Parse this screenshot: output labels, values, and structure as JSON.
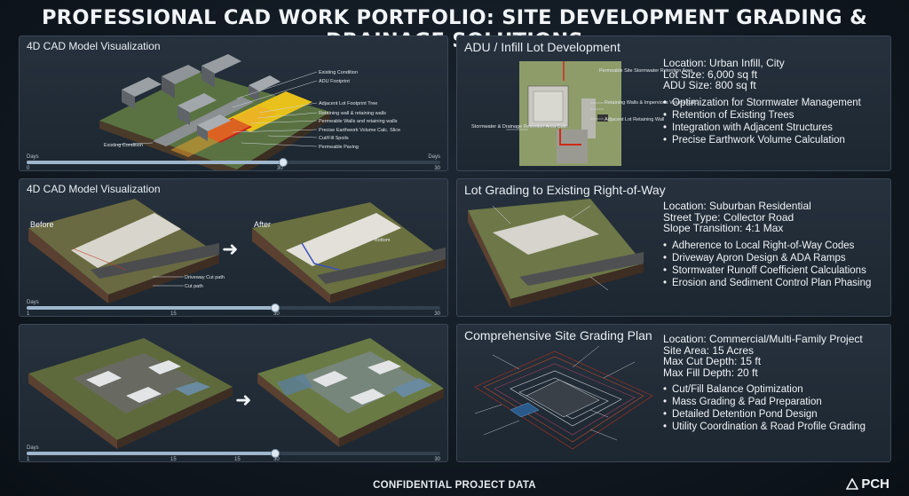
{
  "title": "PROFESSIONAL CAD WORK PORTFOLIO: SITE DEVELOPMENT GRADING & DRAINAGE SOLUTIONS",
  "panels": {
    "p1": {
      "title": "4D CAD Model Visualization",
      "callouts": [
        "Existing Condition",
        "ADU Footprint",
        "Adjacent Lot Footprint Tree",
        "Retaining wall & retaining walls",
        "Permeable Walls and retaining walls",
        "Precise Earthwork Volume Calc. Slice",
        "Cut/Fill Spoils",
        "Permeable Paving"
      ],
      "corner_label": "Existing Condition",
      "timeline": {
        "start_label": "Days",
        "end_label": "Days",
        "ticks": [
          "0",
          "30",
          "30"
        ],
        "progress": 0.62
      }
    },
    "p2": {
      "title": "ADU / Infill Lot Development",
      "callouts_left": [
        "Stormwater & Drainage Retention Area Calc."
      ],
      "callouts_right": [
        "Permeable Site Stormwater Retention Area",
        "Retaining Walls & Impervious Volume Calc.",
        "Adjacent Lot Retaining Wall"
      ],
      "info": {
        "location": "Location: Urban Infill, City",
        "lot_size": "Lot Size: 6,000 sq ft",
        "adu_size": "ADU Size: 800 sq ft",
        "bullets": [
          "Optimization for Stormwater Management",
          "Retention of Existing Trees",
          "Integration with Adjacent Structures",
          "Precise Earthwork Volume Calculation"
        ]
      }
    },
    "p3": {
      "title": "4D CAD Model Visualization",
      "before": "Before",
      "after": "After",
      "arrow": "➜",
      "callouts": [
        "Driveway Cut path",
        "Cut path"
      ],
      "after_label": "Bottom",
      "timeline": {
        "start_label": "Days",
        "ticks": [
          "1",
          "15",
          "30",
          "30"
        ],
        "progress": 0.6
      }
    },
    "p4": {
      "title": "Lot Grading to Existing Right-of-Way",
      "info": {
        "location": "Location: Suburban Residential",
        "street": "Street Type: Collector Road",
        "slope": "Slope Transition: 4:1 Max",
        "bullets": [
          "Adherence to Local Right-of-Way Codes",
          "Driveway Apron Design & ADA Ramps",
          "Stormwater Runoff Coefficient Calculations",
          "Erosion and Sediment Control Plan Phasing"
        ]
      }
    },
    "p5": {
      "arrow": "➜",
      "timeline": {
        "start_label": "Days",
        "ticks": [
          "1",
          "15",
          "15",
          "30",
          "30"
        ],
        "progress": 0.6
      }
    },
    "p6": {
      "title": "Comprehensive Site Grading Plan",
      "info": {
        "location": "Location: Commercial/Multi-Family Project",
        "area": "Site Area: 15 Acres",
        "cut": "Max Cut Depth: 15 ft",
        "fill": "Max Fill Depth: 20 ft",
        "bullets": [
          "Cut/Fill Balance Optimization",
          "Mass Grading & Pad Preparation",
          "Detailed Detention Pond Design",
          "Utility Coordination & Road Profile Grading"
        ]
      }
    }
  },
  "footer": "CONFIDENTIAL PROJECT DATA",
  "logo": "PCH",
  "colors": {
    "accent": "#9fb6cc",
    "panel": "#222c37",
    "border": "#3a4756"
  }
}
